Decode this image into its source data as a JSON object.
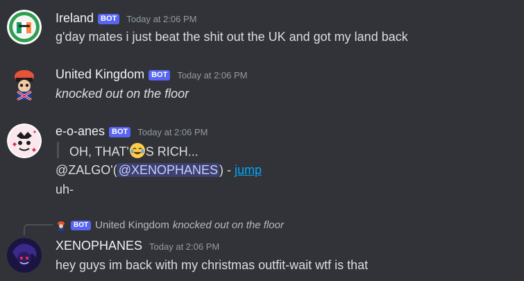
{
  "messages": [
    {
      "username": "Ireland",
      "bot_tag": "BOT",
      "timestamp": "Today at 2:06 PM",
      "lines": [
        "g'day mates i just beat the shit out the UK and got my land back"
      ],
      "avatar_icon": "ireland-flag-avatar-icon"
    },
    {
      "username": "United Kingdom",
      "bot_tag": "BOT",
      "timestamp": "Today at 2:06 PM",
      "lines": [
        "knocked out on the floor"
      ],
      "avatar_icon": "united-kingdom-avatar-icon"
    },
    {
      "username": "e-o-anes",
      "bot_tag": "BOT",
      "timestamp": "Today at 2:06 PM",
      "quote_before": "OH, THAT'",
      "quote_after": "S RICH...",
      "emoji": "joy-emoji-icon",
      "zalgo_prefix": "@ZALGO'(",
      "mention": "@XENOPHANES",
      "zalgo_suffix": ") - ",
      "jump_link": "jump",
      "last_line": "uh-",
      "avatar_icon": "e-o-anes-avatar-icon"
    },
    {
      "username": "XENOPHANES",
      "timestamp": "Today at 2:06 PM",
      "lines": [
        "hey guys im back with my christmas outfit-wait wtf is that"
      ],
      "avatar_icon": "xenophanes-avatar-icon",
      "reply": {
        "bot_tag": "BOT",
        "username": "United Kingdom",
        "text": "knocked out on the floor"
      }
    }
  ],
  "colors": {
    "background": "#313338",
    "bot_tag": "#5865f2",
    "link": "#00a8fc",
    "mention_bg": "#3c4270"
  }
}
